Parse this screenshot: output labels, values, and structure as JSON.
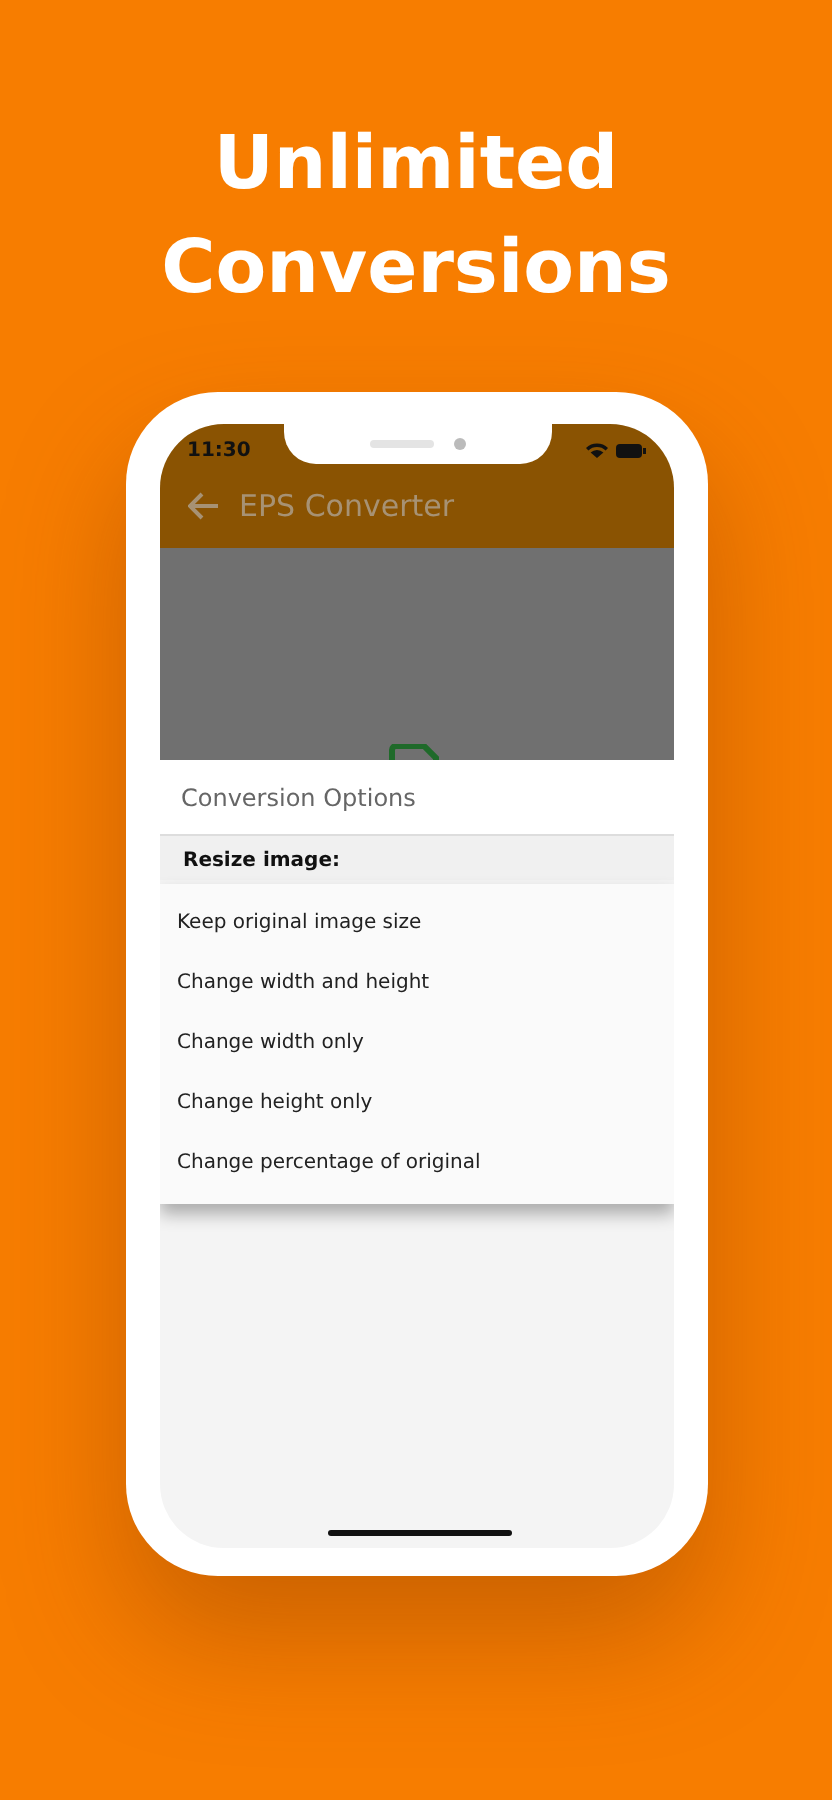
{
  "headline": [
    "Unlimited",
    "Conversions"
  ],
  "status_bar": {
    "time": "11:30"
  },
  "app_bar": {
    "title": "EPS Converter"
  },
  "sheet": {
    "title": "Conversion Options",
    "section_label": "Resize image:"
  },
  "menu": {
    "items": [
      {
        "label": "Keep original image size"
      },
      {
        "label": "Change width and height"
      },
      {
        "label": "Change width only"
      },
      {
        "label": "Change height only"
      },
      {
        "label": "Change percentage of original"
      }
    ]
  }
}
